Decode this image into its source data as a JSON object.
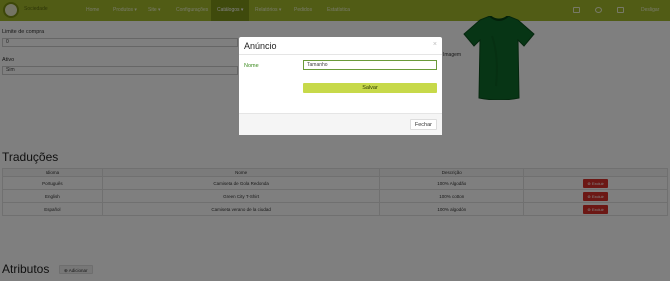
{
  "navbar": {
    "brand": "Sociedade",
    "items": [
      "Home",
      "Produtos ▾",
      "Site ▾",
      "Configurações",
      "Catálogos ▾",
      "Relatórios ▾",
      "Pedidos",
      "Estatística"
    ],
    "active_index": 4,
    "right_items": [
      "mail-icon",
      "user-icon",
      "bell-icon"
    ],
    "logout_label": "Desligar"
  },
  "form": {
    "limite_label": "Limite de compra",
    "limite_value": "0",
    "ativo_label": "Ativo",
    "ativo_value": "Sim",
    "imagem_label": "Imagem"
  },
  "traducoes": {
    "title": "Traduções",
    "columns": [
      "Idioma",
      "Nome",
      "Descrição",
      ""
    ],
    "rows": [
      {
        "idioma": "Português",
        "nome": "Camiseta de Gola Redonda",
        "descricao": "100% Algodão",
        "action": "Excluir"
      },
      {
        "idioma": "English",
        "nome": "Green City T-Shirt",
        "descricao": "100% cotton",
        "action": "Excluir"
      },
      {
        "idioma": "Español",
        "nome": "Camiseta verano de la ciudad",
        "descricao": "100% algodón",
        "action": "Excluir"
      }
    ]
  },
  "atributos": {
    "title": "Atributos",
    "add_label": "Adicionar"
  },
  "modal": {
    "title": "Anúncio",
    "close_glyph": "×",
    "nome_label": "Nome",
    "nome_value": "Tamanho",
    "save_label": "Salvar",
    "fechar_label": "Fechar"
  },
  "colors": {
    "navbar": "#a3b92a",
    "save_button": "#c7d94a",
    "delete_button": "#d9302a",
    "shirt": "#0f6b2a"
  }
}
